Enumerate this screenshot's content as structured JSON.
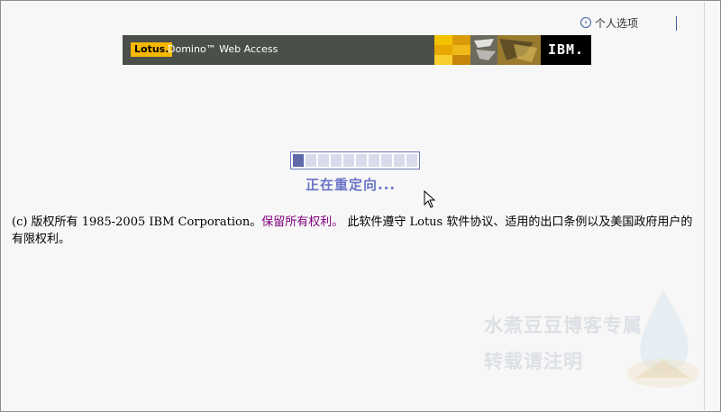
{
  "header": {
    "personal_options": "个人选项"
  },
  "banner": {
    "lotus_label": "Lotus.",
    "product_name": "Domino™ Web Access",
    "ibm_logo": "IBM."
  },
  "progress": {
    "segments": 10,
    "filled": 1,
    "status": "正在重定向..."
  },
  "copyright": {
    "line_prefix": "(c) 版权所有  1985-2005 IBM Corporation。",
    "rights": "保留所有权利。",
    "line_suffix": "  此软件遵守  Lotus 软件协议、适用的出口条例以及美国政府用户的有限权利。"
  },
  "watermark": {
    "line1": "水煮豆豆博客专属",
    "line2": "转载请注明"
  },
  "colors": {
    "banner_bg": "#4b4f4a",
    "lotus_yellow": "#f6b800",
    "progress_on": "#5f6aa8",
    "progress_off": "#d9dbeb",
    "status_text": "#6a74c6",
    "rights_link": "#800080"
  }
}
